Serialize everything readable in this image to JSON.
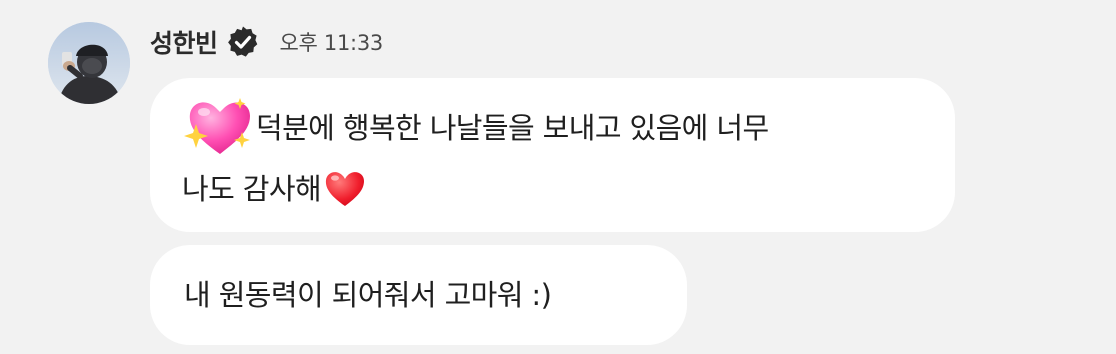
{
  "message": {
    "sender_name": "성한빈",
    "timestamp": "오후 11:33",
    "bubbles": [
      {
        "text_line1": "덕분에 행복한 나날들을 보내고 있음에 너무",
        "text_line2": "나도 감사해",
        "emojis": [
          "sparkling-heart",
          "red-heart"
        ]
      },
      {
        "text": "내 원동력이 되어줘서 고마워 :)"
      }
    ]
  },
  "icons": {
    "verified": "verified-badge-icon"
  },
  "colors": {
    "background": "#f2f2f2",
    "bubble": "#ffffff",
    "badge": "#2b2b2b"
  }
}
